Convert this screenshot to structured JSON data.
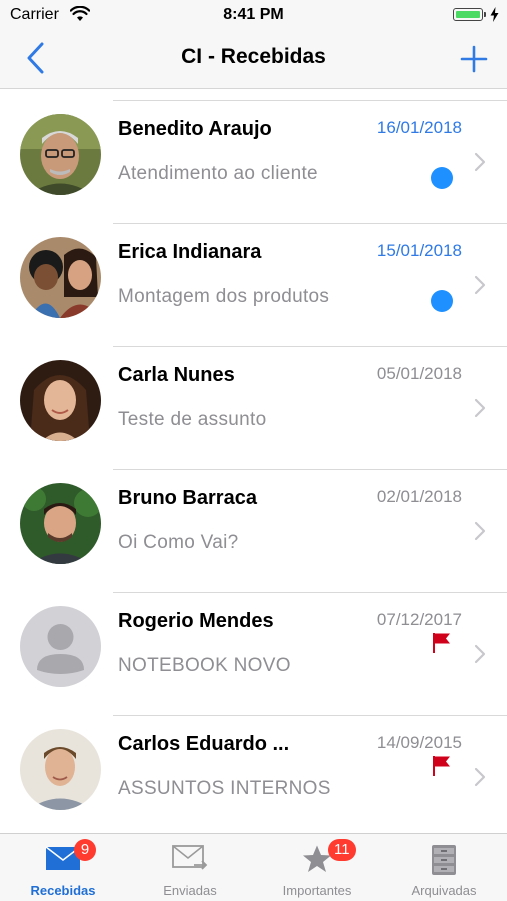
{
  "status_bar": {
    "carrier": "Carrier",
    "time": "8:41 PM"
  },
  "nav": {
    "title": "CI - Recebidas",
    "back_icon": "chevron-left-icon",
    "add_icon": "plus-icon"
  },
  "colors": {
    "accent": "#2f7ae5",
    "unread_dot": "#1e90ff",
    "flag": "#d0021b",
    "badge": "#ff3b30",
    "date_read": "#8e8e93"
  },
  "messages": [
    {
      "name": "Benedito Araujo",
      "date": "16/01/2018",
      "subject": "Atendimento ao cliente",
      "unread": true,
      "flagged": false
    },
    {
      "name": "Erica Indianara",
      "date": "15/01/2018",
      "subject": "Montagem dos produtos",
      "unread": true,
      "flagged": false
    },
    {
      "name": "Carla Nunes",
      "date": "05/01/2018",
      "subject": "Teste de assunto",
      "unread": false,
      "flagged": false
    },
    {
      "name": "Bruno Barraca",
      "date": "02/01/2018",
      "subject": "Oi Como Vai?",
      "unread": false,
      "flagged": false
    },
    {
      "name": "Rogerio Mendes",
      "date": "07/12/2017",
      "subject": "NOTEBOOK NOVO",
      "unread": false,
      "flagged": true
    },
    {
      "name": "Carlos Eduardo ...",
      "date": "14/09/2015",
      "subject": "ASSUNTOS INTERNOS",
      "unread": false,
      "flagged": true
    }
  ],
  "tabs": [
    {
      "label": "Recebidas",
      "icon": "envelope-icon",
      "badge": "9",
      "active": true
    },
    {
      "label": "Enviadas",
      "icon": "sent-mail-icon",
      "badge": "",
      "active": false
    },
    {
      "label": "Importantes",
      "icon": "star-icon",
      "badge": "11",
      "active": false
    },
    {
      "label": "Arquivadas",
      "icon": "filing-cabinet-icon",
      "badge": "",
      "active": false
    }
  ]
}
